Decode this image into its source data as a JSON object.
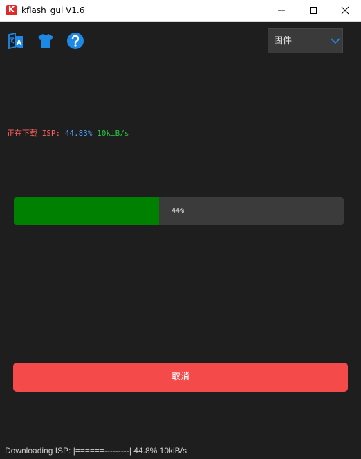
{
  "window": {
    "title": "kflash_gui V1.6",
    "app_icon_letter": "K"
  },
  "toolbar": {
    "language_icon": "translate-icon",
    "skin_icon": "tshirt-icon",
    "help_icon": "help-icon",
    "icon_color": "#1e88e5"
  },
  "dropdown": {
    "selected": "固件"
  },
  "status": {
    "downloading": "正在下载",
    "isp": "ISP:",
    "percent": "44.83%",
    "speed": "10kiB/s"
  },
  "progress": {
    "value": 44,
    "label": "44%",
    "fill_color": "#008000"
  },
  "cancel_button": {
    "label": "取消",
    "color": "#f44a4a"
  },
  "statusbar": {
    "text": "Downloading ISP: |======---------| 44.8% 10kiB/s"
  }
}
